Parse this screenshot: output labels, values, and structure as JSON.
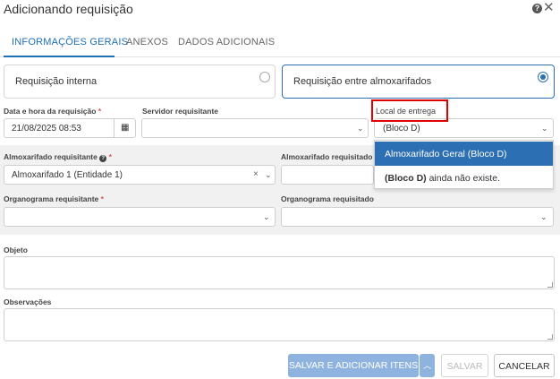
{
  "header": {
    "title": "Adicionando requisição",
    "help_icon": "?",
    "close_icon": "✕"
  },
  "tabs": [
    {
      "label": "INFORMAÇÕES GERAIS",
      "active": true
    },
    {
      "label": "ANEXOS",
      "active": false
    },
    {
      "label": "DADOS ADICIONAIS",
      "active": false
    }
  ],
  "request_type": {
    "internal_label": "Requisição interna",
    "internal_checked": false,
    "between_label": "Requisição entre almoxarifados",
    "between_checked": true
  },
  "fields": {
    "datetime": {
      "label": "Data e hora da requisição",
      "value": "21/08/2025 08:53",
      "required": "*"
    },
    "servidor": {
      "label": "Servidor requisitante",
      "value": ""
    },
    "local_entrega": {
      "label": "Local de entrega",
      "value": "(Bloco D)"
    },
    "almox_requisitante": {
      "label": "Almoxarifado requisitante",
      "value": "Almoxarifado 1 (Entidade 1)",
      "required": "*"
    },
    "almox_requisitado": {
      "label": "Almoxarifado requisitado"
    },
    "org_requisitante": {
      "label": "Organograma requisitante",
      "value": "",
      "required": "*"
    },
    "org_requisitado": {
      "label": "Organograma requisitado",
      "value": ""
    },
    "objeto": {
      "label": "Objeto",
      "value": ""
    },
    "observacoes": {
      "label": "Observações",
      "value": ""
    }
  },
  "dropdown": {
    "option1": "Almoxarifado Geral (Bloco D)",
    "option2_bold": "(Bloco D)",
    "option2_rest": " ainda não existe."
  },
  "buttons": {
    "save_add_items": "SALVAR E ADICIONAR ITENS",
    "save": "SALVAR",
    "cancel": "CANCELAR"
  },
  "colors": {
    "accent": "#1f6fb5",
    "highlight": "#e00000",
    "primary_button": "#8fb3df"
  }
}
